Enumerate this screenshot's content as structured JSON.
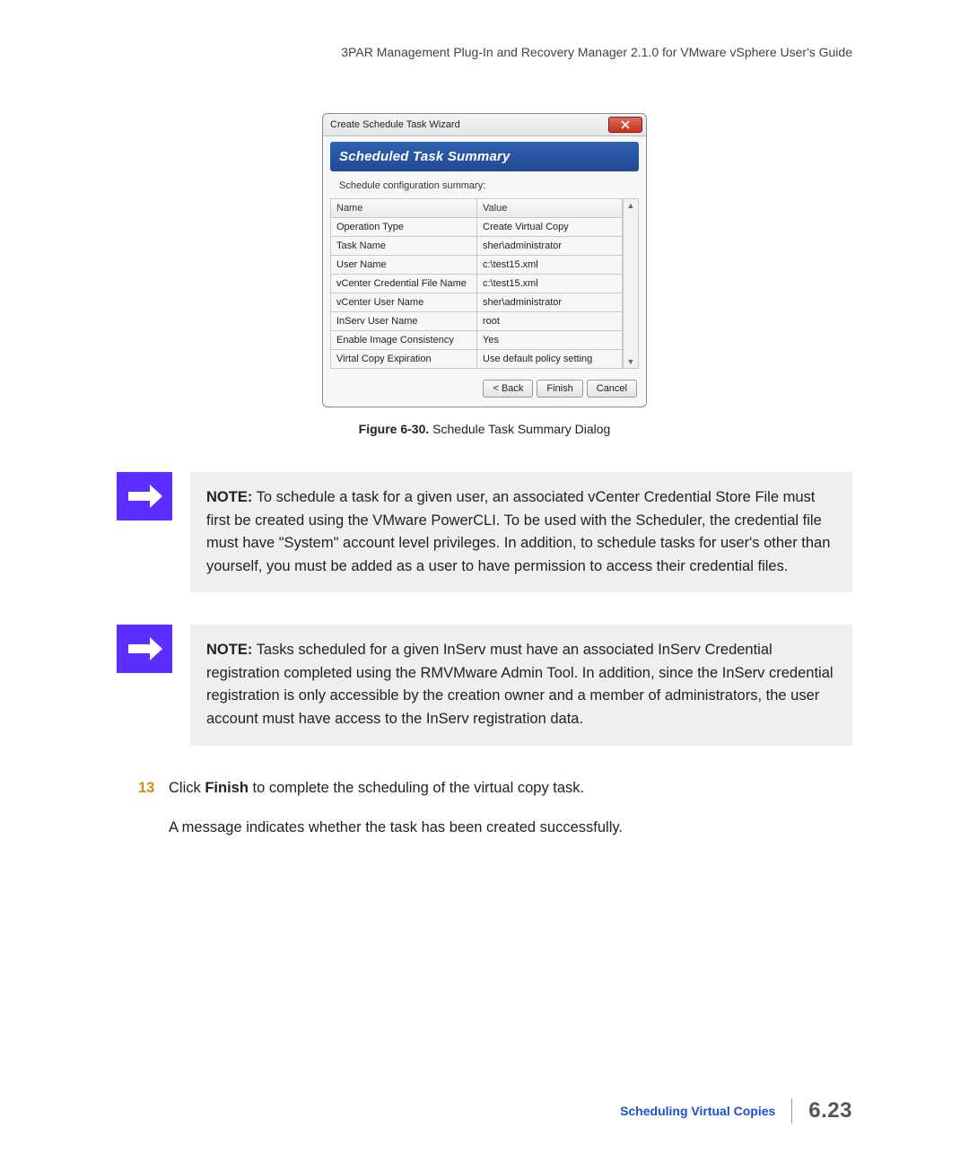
{
  "header": {
    "title": "3PAR Management Plug-In and Recovery Manager 2.1.0 for VMware vSphere User's Guide"
  },
  "dialog": {
    "title": "Create Schedule Task Wizard",
    "banner": "Scheduled Task Summary",
    "subhead": "Schedule configuration summary:",
    "col_name": "Name",
    "col_value": "Value",
    "rows": [
      {
        "name": "Operation Type",
        "value": "Create Virtual Copy"
      },
      {
        "name": "Task Name",
        "value": "sher\\administrator"
      },
      {
        "name": "User Name",
        "value": "c:\\test15.xml"
      },
      {
        "name": "vCenter Credential File Name",
        "value": "c:\\test15.xml"
      },
      {
        "name": "vCenter User Name",
        "value": "sher\\administrator"
      },
      {
        "name": "InServ User Name",
        "value": "root"
      },
      {
        "name": "Enable Image Consistency",
        "value": "Yes"
      },
      {
        "name": "Virtal Copy Expiration",
        "value": "Use default policy setting"
      }
    ],
    "buttons": {
      "back": "< Back",
      "finish": "Finish",
      "cancel": "Cancel"
    }
  },
  "figure": {
    "label": "Figure 6-30.",
    "caption": "Schedule Task Summary Dialog"
  },
  "notes": {
    "n1_label": "NOTE:",
    "n1_text": " To schedule a task for a given user, an associated vCenter Credential Store File must first be created using the VMware PowerCLI. To be used with the Scheduler, the credential file must have \"System\" account level privileges. In addition, to schedule tasks for user's other than yourself, you must be added as a user to have permission to access their credential files.",
    "n2_label": "NOTE:",
    "n2_text": "  Tasks scheduled for a given InServ must have an associated InServ Credential registration completed using the RMVMware Admin Tool. In addition, since the InServ credential registration is only accessible by the creation owner and a member of administrators, the user account must have access to the InServ registration data."
  },
  "step": {
    "number": "13",
    "text_pre": "Click ",
    "text_bold": "Finish",
    "text_post": " to complete the scheduling of the virtual copy task.",
    "sub": "A message indicates whether the task has been created successfully."
  },
  "footer": {
    "section": "Scheduling Virtual Copies",
    "page": "6.23"
  }
}
